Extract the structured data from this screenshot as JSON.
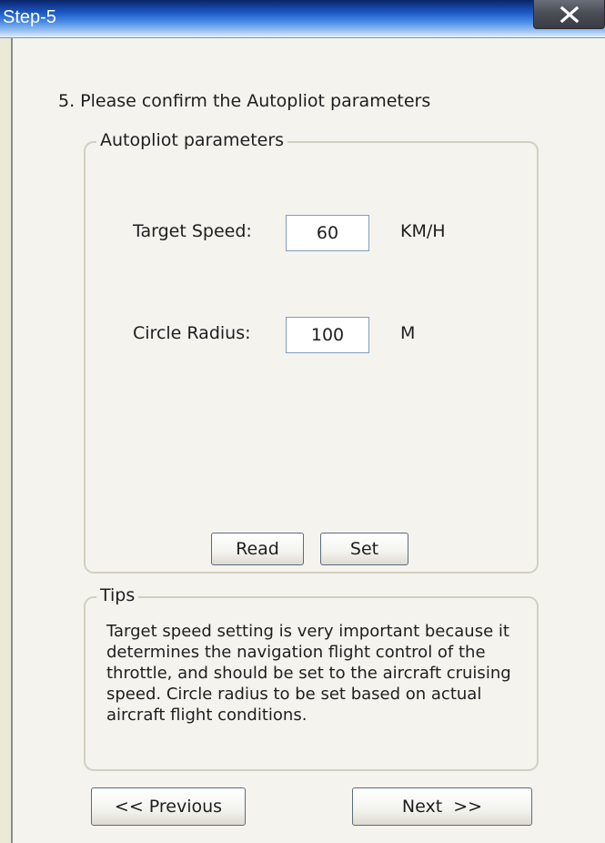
{
  "window": {
    "title": "Step-5",
    "close_glyph": "X"
  },
  "heading": "5. Please confirm the Autopliot parameters",
  "params": {
    "legend": "Autopliot parameters",
    "target_speed": {
      "label": "Target Speed:",
      "value": "60",
      "unit": "KM/H"
    },
    "circle_radius": {
      "label": "Circle Radius:",
      "value": "100",
      "unit": "M"
    },
    "read_label": "Read",
    "set_label": "Set"
  },
  "tips": {
    "legend": "Tips",
    "text": "Target speed setting is very important because it determines the navigation flight control of the throttle, and should be set to the aircraft cruising speed. Circle radius to be set based on actual aircraft flight conditions."
  },
  "nav": {
    "previous_label": "<< Previous",
    "next_label": "Next  >>"
  },
  "colors": {
    "titlebar_start": "#0a246a",
    "titlebar_end": "#e3eefb",
    "background": "#f4f3ee",
    "groupbox_border": "#d0d0bf",
    "input_border": "#7f9db9"
  },
  "icons": {
    "close": "close-icon"
  }
}
